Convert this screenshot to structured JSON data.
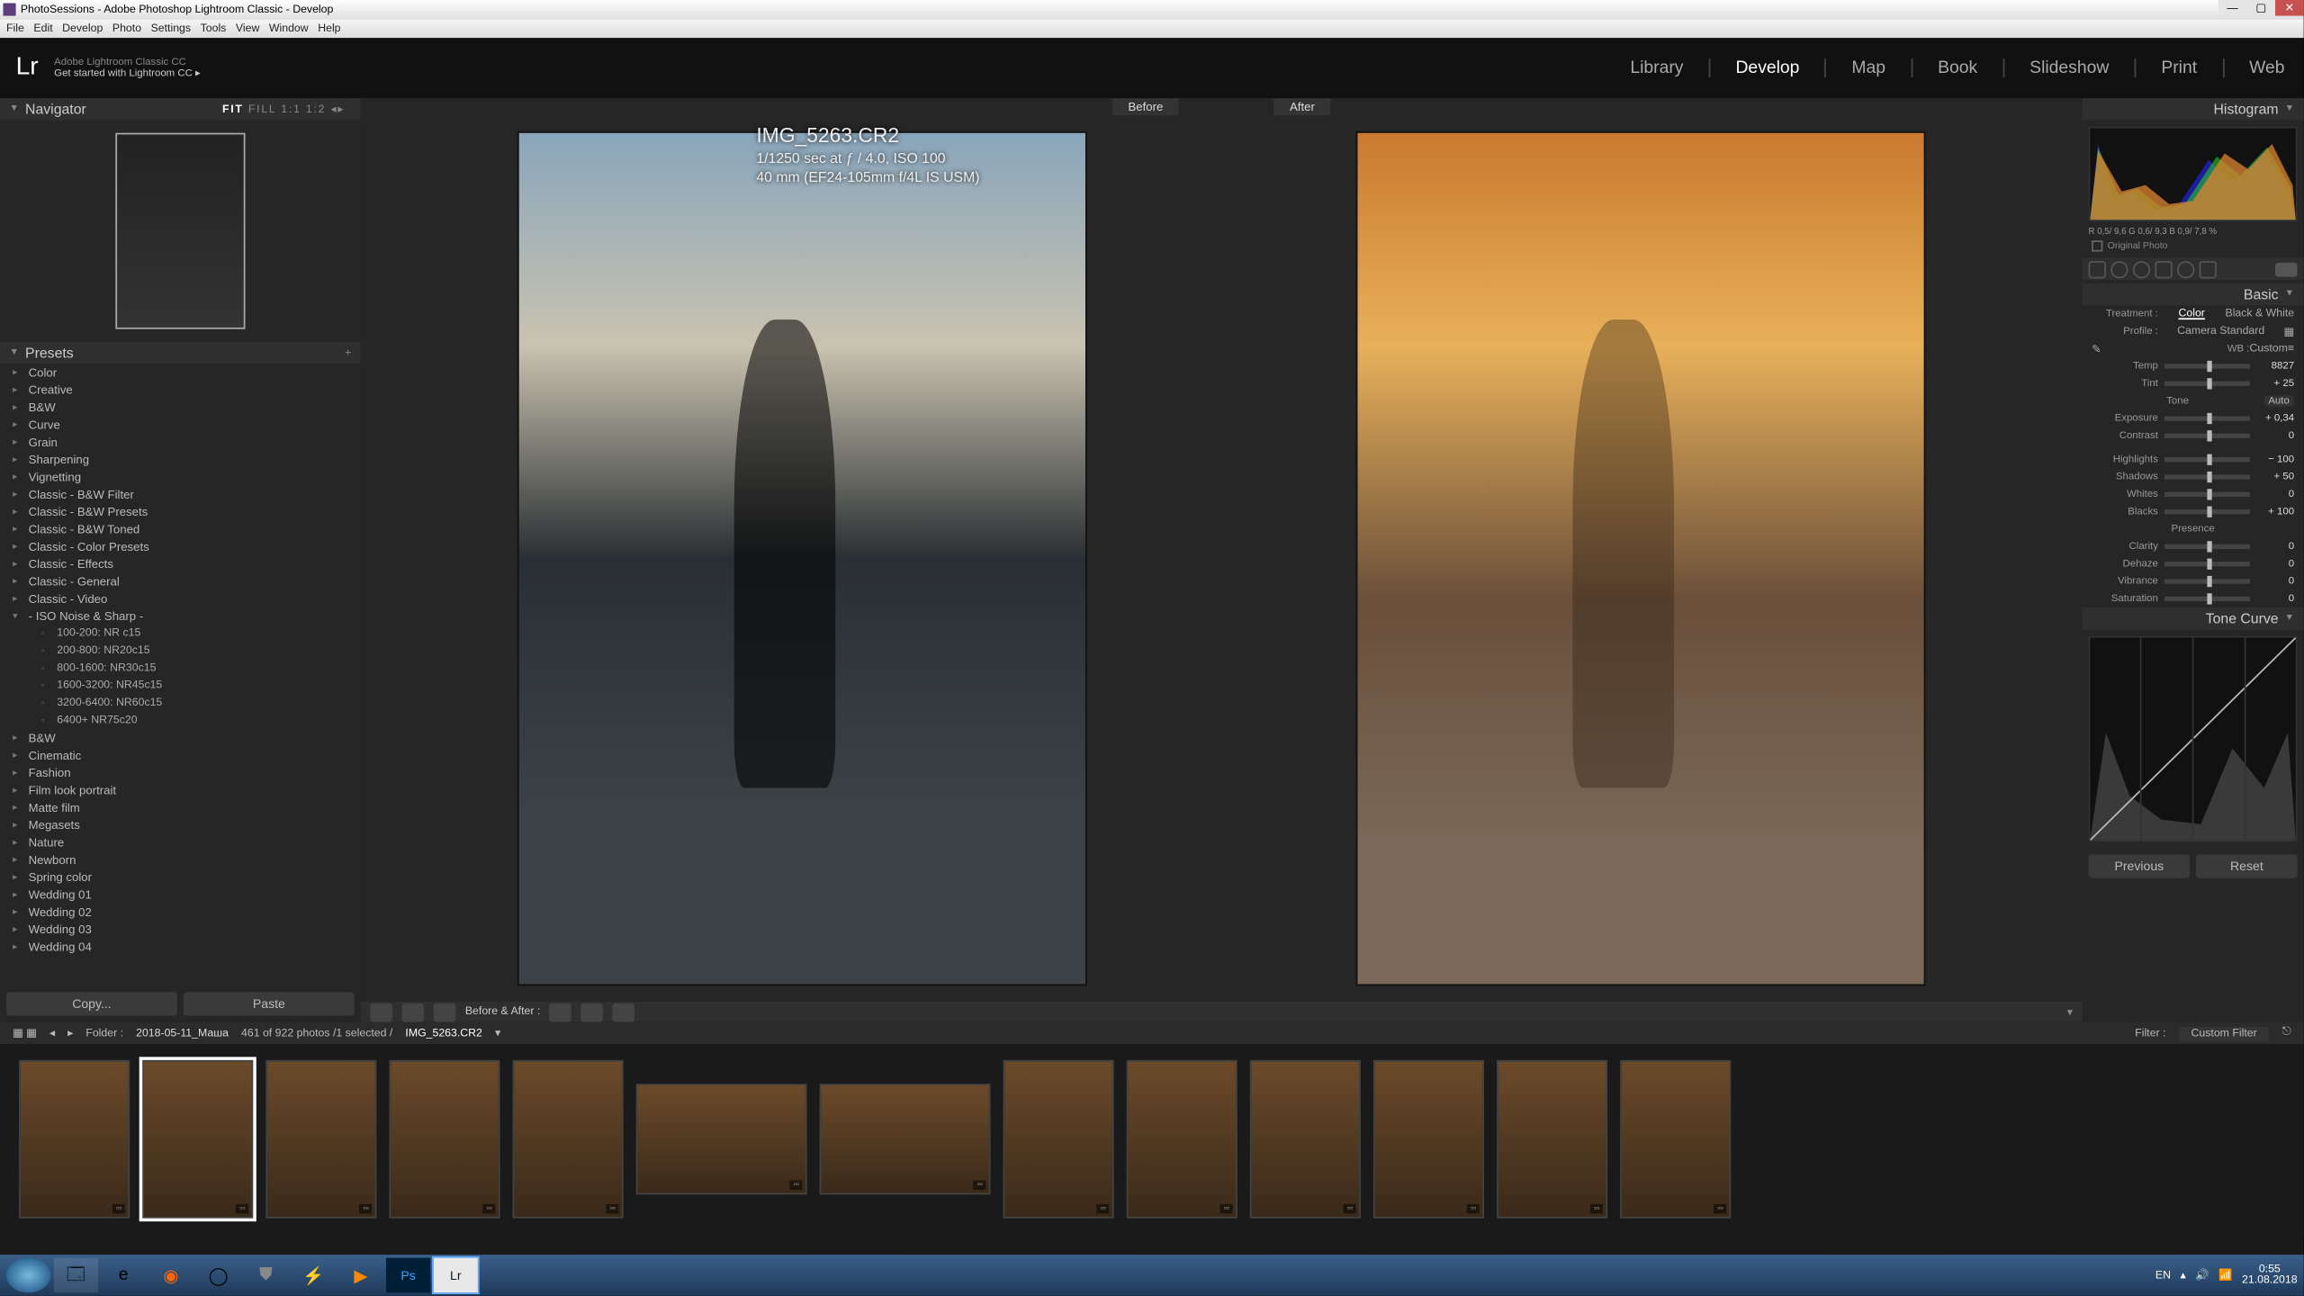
{
  "window_title": "PhotoSessions - Adobe Photoshop Lightroom Classic - Develop",
  "menu": [
    "File",
    "Edit",
    "Develop",
    "Photo",
    "Settings",
    "Tools",
    "View",
    "Window",
    "Help"
  ],
  "header": {
    "sub1": "Adobe Lightroom Classic CC",
    "sub2": "Get started with Lightroom CC  ▸"
  },
  "modules": [
    "Library",
    "Develop",
    "Map",
    "Book",
    "Slideshow",
    "Print",
    "Web"
  ],
  "active_module": "Develop",
  "navigator": {
    "title": "Navigator",
    "zoom": [
      "FIT",
      "FILL",
      "1:1",
      "1:2"
    ],
    "active_zoom": "FIT"
  },
  "presets": {
    "title": "Presets",
    "groups": [
      "Color",
      "Creative",
      "B&W",
      "Curve",
      "Grain",
      "Sharpening",
      "Vignetting",
      "Classic - B&W Filter",
      "Classic - B&W Presets",
      "Classic - B&W Toned",
      "Classic - Color Presets",
      "Classic - Effects",
      "Classic - General",
      "Classic - Video"
    ],
    "open_group": "- ISO Noise & Sharp -",
    "open_items": [
      "100-200: NR c15",
      "200-800: NR20c15",
      "800-1600: NR30c15",
      "1600-3200: NR45c15",
      "3200-6400: NR60c15",
      "6400+ NR75c20"
    ],
    "groups2": [
      "B&W",
      "Cinematic",
      "Fashion",
      "Film look portrait",
      "Matte film",
      "Megasets",
      "Nature",
      "Newborn",
      "Spring color",
      "Wedding 01",
      "Wedding 02",
      "Wedding 03",
      "Wedding 04"
    ],
    "copy": "Copy...",
    "paste": "Paste"
  },
  "center": {
    "before": "Before",
    "after": "After",
    "filename": "IMG_5263.CR2",
    "line2": "1/1250 sec at ƒ / 4.0, ISO 100",
    "line3": "40 mm (EF24-105mm f/4L IS USM)",
    "ba_label": "Before & After :"
  },
  "hist": {
    "title": "Histogram",
    "vals": [
      "R  0,5/",
      "9,6",
      "G  0,6/",
      "9,3",
      "B  0,9/",
      "7,8 %"
    ],
    "orig": "Original Photo"
  },
  "basic": {
    "title": "Basic",
    "treatment_lbl": "Treatment :",
    "treat_color": "Color",
    "treat_bw": "Black & White",
    "profile_lbl": "Profile :",
    "profile": "Camera Standard",
    "wb_lbl": "WB :",
    "wb": "Custom",
    "sliders1": [
      {
        "lbl": "Temp",
        "val": "8827"
      },
      {
        "lbl": "Tint",
        "val": "+ 25"
      }
    ],
    "tone_lbl": "Tone",
    "tone_auto": "Auto",
    "sliders2": [
      {
        "lbl": "Exposure",
        "val": "+ 0,34"
      },
      {
        "lbl": "Contrast",
        "val": "0"
      }
    ],
    "sliders3": [
      {
        "lbl": "Highlights",
        "val": "− 100"
      },
      {
        "lbl": "Shadows",
        "val": "+ 50"
      },
      {
        "lbl": "Whites",
        "val": "0"
      },
      {
        "lbl": "Blacks",
        "val": "+ 100"
      }
    ],
    "presence": "Presence",
    "sliders4": [
      {
        "lbl": "Clarity",
        "val": "0"
      },
      {
        "lbl": "Dehaze",
        "val": "0"
      },
      {
        "lbl": "Vibrance",
        "val": "0"
      },
      {
        "lbl": "Saturation",
        "val": "0"
      }
    ]
  },
  "tcurve": {
    "title": "Tone Curve"
  },
  "prev_reset": {
    "prev": "Previous",
    "reset": "Reset"
  },
  "strip": {
    "folder_lbl": "Folder :",
    "folder": "2018-05-11_Маша",
    "count": "461 of 922 photos /1 selected /",
    "file": "IMG_5263.CR2",
    "filter_lbl": "Filter :",
    "filter": "Custom Filter"
  },
  "taskbar": {
    "lang": "EN",
    "time": "0:55",
    "date": "21.08.2018"
  }
}
